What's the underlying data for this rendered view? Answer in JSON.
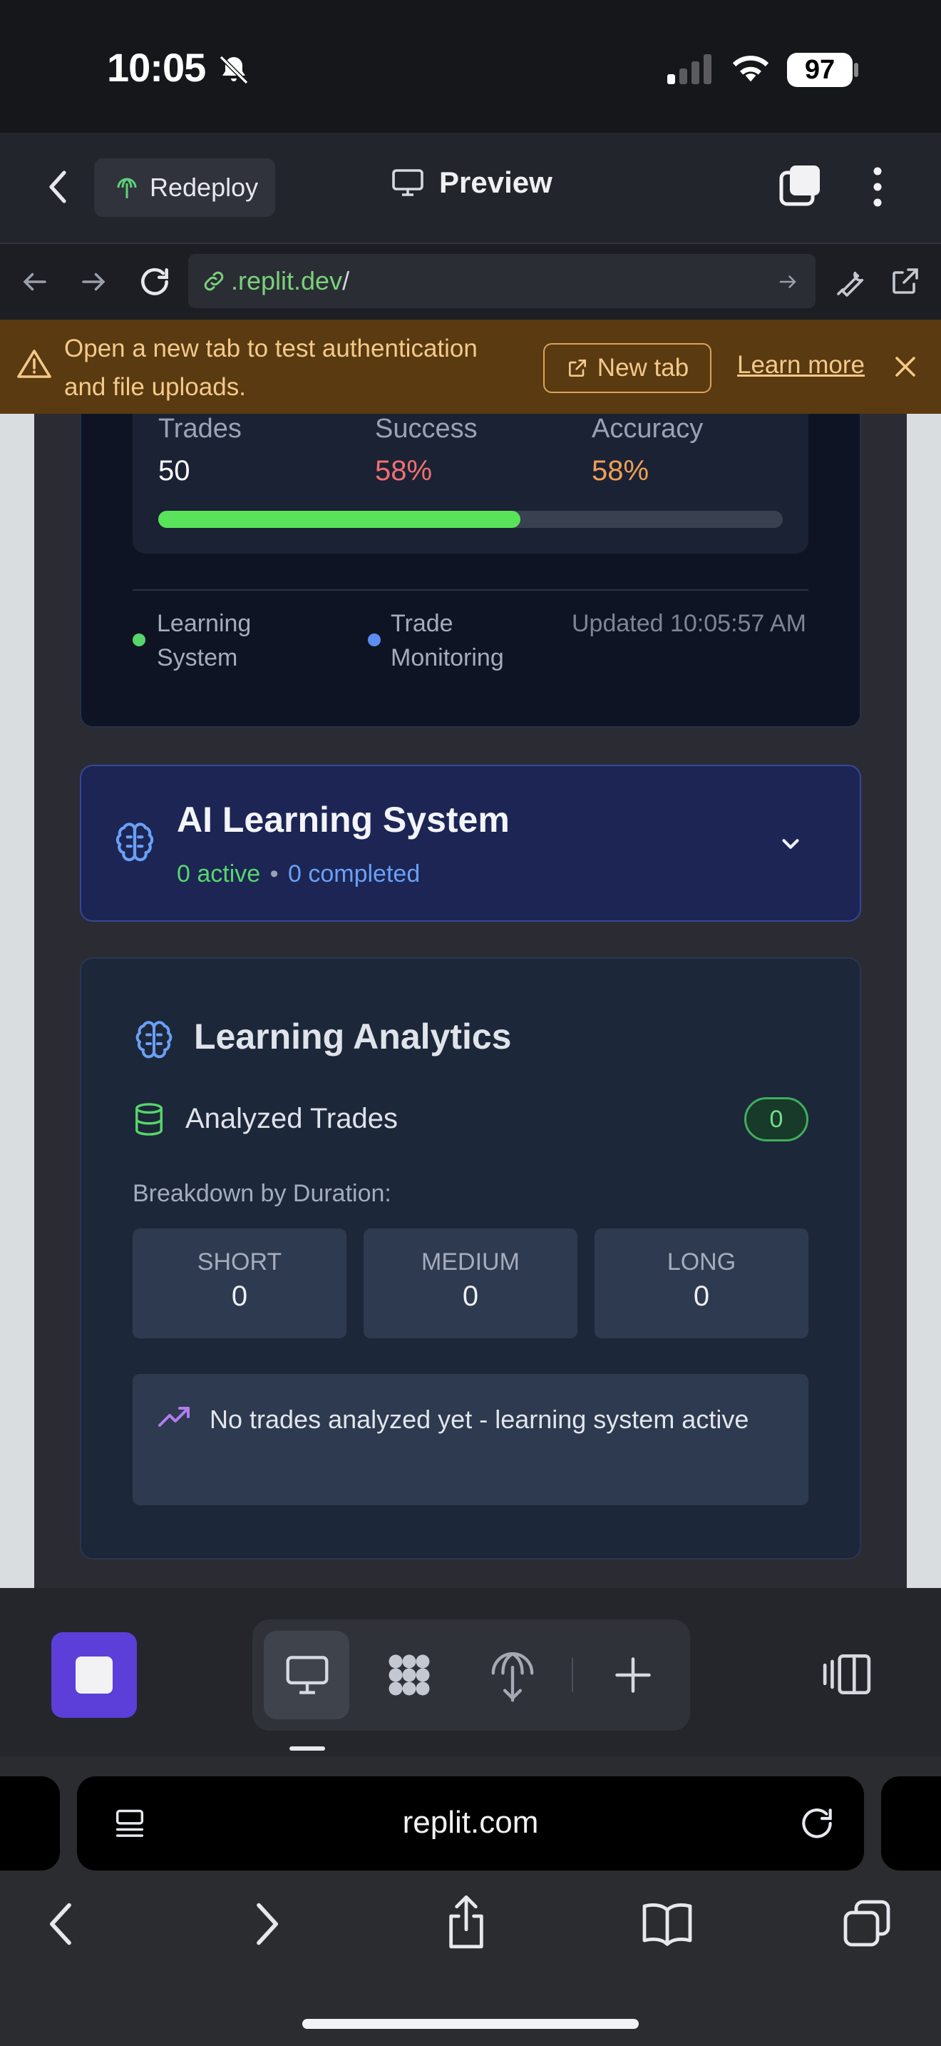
{
  "status_bar": {
    "time": "10:05",
    "battery": "97"
  },
  "replit_header": {
    "redeploy_label": "Redeploy",
    "preview_label": "Preview"
  },
  "url_bar": {
    "host": ".replit.dev",
    "path": "/"
  },
  "banner": {
    "message": "Open a new tab to test authentication and file uploads.",
    "new_tab_label": "New tab",
    "learn_more_label": "Learn more"
  },
  "stats": {
    "trades_label": "Trades",
    "trades_value": "50",
    "success_label": "Success",
    "success_value": "58%",
    "accuracy_label": "Accuracy",
    "accuracy_value": "58%",
    "progress_fraction": 0.58,
    "legend": [
      {
        "label": "Learning System",
        "color": "#58d66a"
      },
      {
        "label": "Trade Monitoring",
        "color": "#5b8ef0"
      }
    ],
    "updated": "Updated 10:05:57 AM"
  },
  "ai_system": {
    "title": "AI Learning System",
    "active": "0 active",
    "separator": "•",
    "completed": "0 completed"
  },
  "analytics": {
    "title": "Learning Analytics",
    "analyzed_label": "Analyzed Trades",
    "analyzed_count": "0",
    "breakdown_label": "Breakdown by Duration:",
    "durations": [
      {
        "name": "SHORT",
        "value": "0"
      },
      {
        "name": "MEDIUM",
        "value": "0"
      },
      {
        "name": "LONG",
        "value": "0"
      }
    ],
    "empty_message": "No trades analyzed yet - learning system active"
  },
  "safari": {
    "url": "replit.com"
  },
  "colors": {
    "accent_purple": "#5b3fd8",
    "success_red": "#f07070",
    "accuracy_orange": "#f0a055",
    "progress_green": "#58e35a",
    "active_green": "#58d66a",
    "completed_blue": "#6aa0f5"
  }
}
